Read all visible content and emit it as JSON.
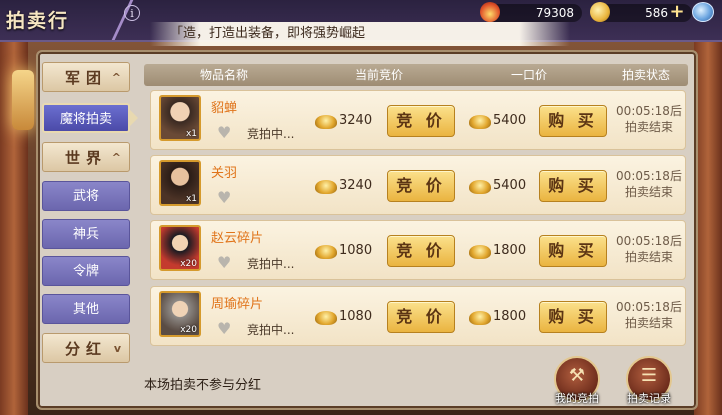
{
  "header": {
    "title": "拍卖行",
    "info_icon": "i",
    "resource_a_value": "79308",
    "resource_b_value": "586",
    "plus_label": "+"
  },
  "marquee": {
    "text_before": "「造，打造出装备",
    "text_highlight": "",
    "text_after": "，即将强势崛起"
  },
  "sidebar": {
    "group_legion": "军团",
    "item_active": "魔将拍卖",
    "group_world": "世界",
    "items": [
      "武将",
      "神兵",
      "令牌",
      "其他"
    ],
    "group_dividend": "分红",
    "arrow_up": "^",
    "arrow_down": "v"
  },
  "table": {
    "headers": [
      "物品名称",
      "当前竞价",
      "一口价",
      "拍卖状态"
    ],
    "rows": [
      {
        "name": "貂蝉",
        "qty": "x1",
        "status": "竞拍中...",
        "current_bid": "3240",
        "bid_label": "竞 价",
        "buyout": "5400",
        "buy_label": "购 买",
        "time_line1": "00:05:18后",
        "time_line2": "拍卖结束"
      },
      {
        "name": "关羽",
        "qty": "x1",
        "status": "",
        "current_bid": "3240",
        "bid_label": "竞 价",
        "buyout": "5400",
        "buy_label": "购 买",
        "time_line1": "00:05:18后",
        "time_line2": "拍卖结束"
      },
      {
        "name": "赵云碎片",
        "qty": "x20",
        "status": "竞拍中...",
        "current_bid": "1080",
        "bid_label": "竞 价",
        "buyout": "1800",
        "buy_label": "购 买",
        "time_line1": "00:05:18后",
        "time_line2": "拍卖结束"
      },
      {
        "name": "周瑜碎片",
        "qty": "x20",
        "status": "竞拍中...",
        "current_bid": "1080",
        "bid_label": "竞 价",
        "buyout": "1800",
        "buy_label": "购 买",
        "time_line1": "00:05:18后",
        "time_line2": "拍卖结束"
      }
    ]
  },
  "footer": {
    "note": "本场拍卖不参与分红",
    "my_bids_label": "我的竞拍",
    "auction_log_label": "拍卖记录"
  },
  "icons": {
    "heart": "favorite-heart-icon",
    "gold": "gold-ingot-icon",
    "gem": "gem-icon",
    "fire": "fire-currency-icon"
  }
}
